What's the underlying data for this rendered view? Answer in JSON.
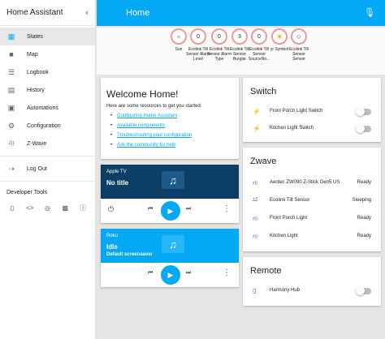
{
  "sidebar": {
    "title": "Home Assistant",
    "items": [
      {
        "label": "States",
        "icon": "grid-icon"
      },
      {
        "label": "Map",
        "icon": "person-icon"
      },
      {
        "label": "Logbook",
        "icon": "list-icon"
      },
      {
        "label": "History",
        "icon": "bar-chart-icon"
      },
      {
        "label": "Automations",
        "icon": "robot-icon"
      },
      {
        "label": "Configuration",
        "icon": "gear-icon"
      },
      {
        "label": "Z-Wave",
        "icon": "zwave-icon"
      },
      {
        "label": "Log Out",
        "icon": "logout-icon"
      }
    ],
    "developer_tools_label": "Developer Tools",
    "developer_tools": [
      "remote-icon",
      "code-icon",
      "podcast-icon",
      "file-icon",
      "info-icon"
    ]
  },
  "header": {
    "title": "Home",
    "mic_icon": "microphone-icon"
  },
  "badges": [
    {
      "value": "",
      "label": "Sun",
      "icon": "sun-icon"
    },
    {
      "value": "0",
      "label": "Ecolink Tilt Sensor Alarm Level"
    },
    {
      "value": "0",
      "label": "Ecolink Tilt Sensor Alarm Type"
    },
    {
      "value": "3",
      "label": "Ecolink Tilt Sensor Burglar"
    },
    {
      "value": "0",
      "label": "Ecolink Tilt Sensor SourceNo..."
    },
    {
      "value": "",
      "label": "yr Symbol",
      "icon": "weather-sun-icon"
    },
    {
      "value": "",
      "label": "Ecolink Tilt Sensor Sensor",
      "icon": "circle-icon"
    }
  ],
  "welcome": {
    "title": "Welcome Home!",
    "intro": "Here are some resources to get you started.",
    "links": [
      "Configuring Home Assistant",
      "Available components",
      "Troubleshooting your configuration",
      "Ask the community for help"
    ]
  },
  "media_players": [
    {
      "name": "Apple TV",
      "state": "No title",
      "subtitle": "",
      "bg": "#0d3f66"
    },
    {
      "name": "Roku",
      "state": "Idle",
      "subtitle": "Default screensaver",
      "bg": "#03a9f4"
    }
  ],
  "switch_card": {
    "title": "Switch",
    "rows": [
      {
        "label": "Front Porch Light Switch",
        "icon": "bolt-icon"
      },
      {
        "label": "Kitchen Light Switch",
        "icon": "bolt-icon"
      }
    ]
  },
  "zwave_card": {
    "title": "Zwave",
    "rows": [
      {
        "label": "Aeotec ZW090 Z-Stick Gen5 US",
        "status": "Ready",
        "icon": "zwave-icon"
      },
      {
        "label": "Ecolink Tilt Sensor",
        "status": "Sleeping",
        "icon": "sleep-icon"
      },
      {
        "label": "Front Porch Light",
        "status": "Ready",
        "icon": "zwave-icon"
      },
      {
        "label": "Kitchen Light",
        "status": "Ready",
        "icon": "zwave-icon"
      }
    ]
  },
  "remote_card": {
    "title": "Remote",
    "rows": [
      {
        "label": "Harmony Hub",
        "icon": "remote-icon"
      }
    ]
  },
  "colors": {
    "accent": "#03a9f4",
    "badge_border": "#ef9a9a",
    "appletv_bg": "#0d3f66"
  }
}
